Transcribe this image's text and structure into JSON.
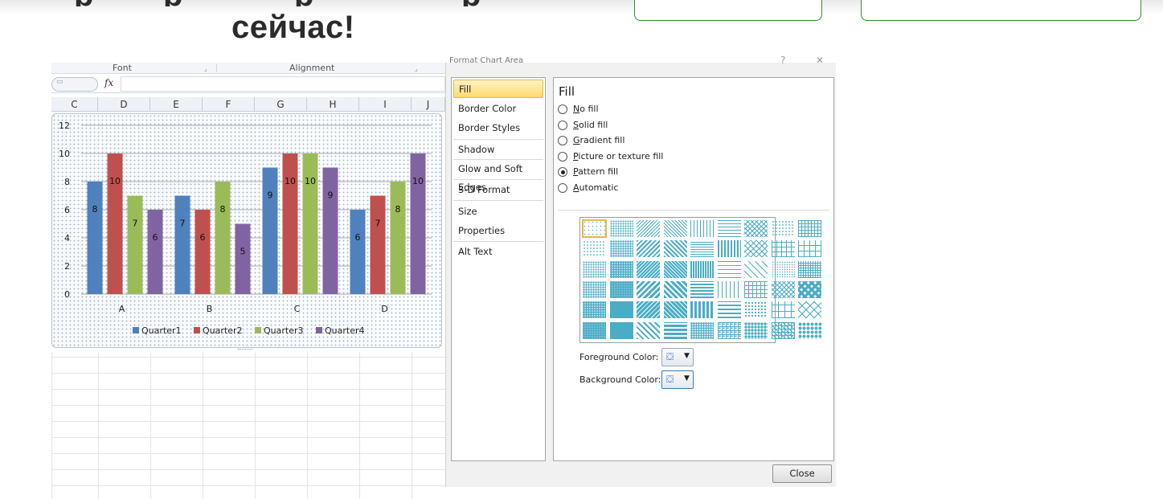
{
  "banner": {
    "headline_line2": "сейчас!",
    "headline_line1_fragments": [
      "р",
      "р",
      "р",
      "р"
    ]
  },
  "excel": {
    "ribbon_groups": [
      "Font",
      "Alignment"
    ],
    "fx_label": "fx",
    "columns": [
      "C",
      "D",
      "E",
      "F",
      "G",
      "H",
      "I",
      "J"
    ]
  },
  "chart_data": {
    "type": "bar",
    "categories": [
      "A",
      "B",
      "C",
      "D"
    ],
    "series": [
      {
        "name": "Quarter1",
        "color": "#4f81bd",
        "values": [
          8,
          7,
          9,
          6
        ]
      },
      {
        "name": "Quarter2",
        "color": "#c0504d",
        "values": [
          10,
          6,
          10,
          7
        ]
      },
      {
        "name": "Quarter3",
        "color": "#9bbb59",
        "values": [
          7,
          8,
          10,
          8
        ]
      },
      {
        "name": "Quarter4",
        "color": "#8064a2",
        "values": [
          6,
          5,
          9,
          10
        ]
      }
    ],
    "ylim": [
      0,
      12
    ],
    "yticks": [
      0,
      2,
      4,
      6,
      8,
      10,
      12
    ],
    "data_labels": true,
    "legend": "bottom",
    "grid": true
  },
  "dialog": {
    "title": "Format Chart Area",
    "nav_items": [
      "Fill",
      "Border Color",
      "Border Styles",
      "Shadow",
      "Glow and Soft Edges",
      "3-D Format",
      "Size",
      "Properties",
      "Alt Text"
    ],
    "selected_nav": "Fill",
    "panel_title": "Fill",
    "fill_options": [
      {
        "key": "N",
        "rest": "o fill",
        "checked": false
      },
      {
        "key": "S",
        "rest": "olid fill",
        "checked": false
      },
      {
        "key": "G",
        "rest": "radient fill",
        "checked": false
      },
      {
        "key": "P",
        "rest": "icture or texture fill",
        "checked": false
      },
      {
        "key": "",
        "pre": "P",
        "key2": "a",
        "rest": "ttern fill",
        "checked": true
      },
      {
        "key": "",
        "pre": "A",
        "key2": "u",
        "rest": "tomatic",
        "checked": false
      }
    ],
    "foreground_label": "Foreground Color:",
    "background_label": "Background Color:",
    "close_label": "Close",
    "pattern_color": "#4bacc6"
  }
}
